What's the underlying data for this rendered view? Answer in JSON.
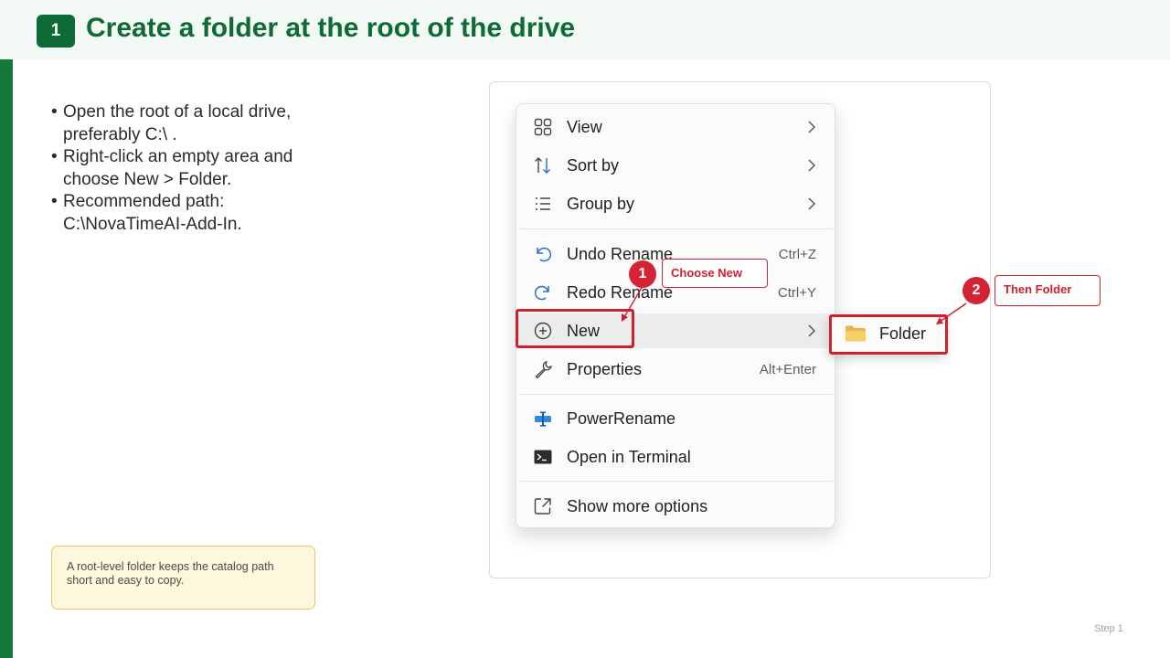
{
  "header": {
    "step_number": "1",
    "title": "Create a folder at the root of the drive"
  },
  "instructions": [
    "Open the root of a local drive, preferably C:\\ .",
    "Right-click an empty area and choose New > Folder.",
    "Recommended path: C:\\NovaTimeAI-Add-In."
  ],
  "note": "A root-level folder keeps the catalog path short and easy to copy.",
  "footer": {
    "step_label": "Step 1"
  },
  "context_menu": {
    "items": [
      {
        "label": "View",
        "icon": "grid-view-icon",
        "shortcut": "",
        "has_submenu": true
      },
      {
        "label": "Sort by",
        "icon": "sort-icon",
        "shortcut": "",
        "has_submenu": true
      },
      {
        "label": "Group by",
        "icon": "group-list-icon",
        "shortcut": "",
        "has_submenu": true
      },
      {
        "label": "Undo Rename",
        "icon": "undo-icon",
        "shortcut": "Ctrl+Z",
        "has_submenu": false
      },
      {
        "label": "Redo Rename",
        "icon": "redo-icon",
        "shortcut": "Ctrl+Y",
        "has_submenu": false
      },
      {
        "label": "New",
        "icon": "add-circle-icon",
        "shortcut": "",
        "has_submenu": true
      },
      {
        "label": "Properties",
        "icon": "wrench-icon",
        "shortcut": "Alt+Enter",
        "has_submenu": false
      },
      {
        "label": "PowerRename",
        "icon": "powerrename-icon",
        "shortcut": "",
        "has_submenu": false
      },
      {
        "label": "Open in Terminal",
        "icon": "terminal-icon",
        "shortcut": "",
        "has_submenu": false
      },
      {
        "label": "Show more options",
        "icon": "show-more-icon",
        "shortcut": "",
        "has_submenu": false
      }
    ]
  },
  "submenu": {
    "items": [
      {
        "label": "Folder",
        "icon": "folder-icon"
      }
    ]
  },
  "annotations": [
    {
      "number": "1",
      "text": "Choose New"
    },
    {
      "number": "2",
      "text": "Then Folder"
    }
  ],
  "colors": {
    "brand_green": "#0e6b35",
    "sidebar_green": "#137a3b",
    "highlight_red": "#cf2030",
    "note_background": "#fff7dc",
    "note_border": "#e8c56d",
    "folder_yellow": "#f2c94c"
  }
}
